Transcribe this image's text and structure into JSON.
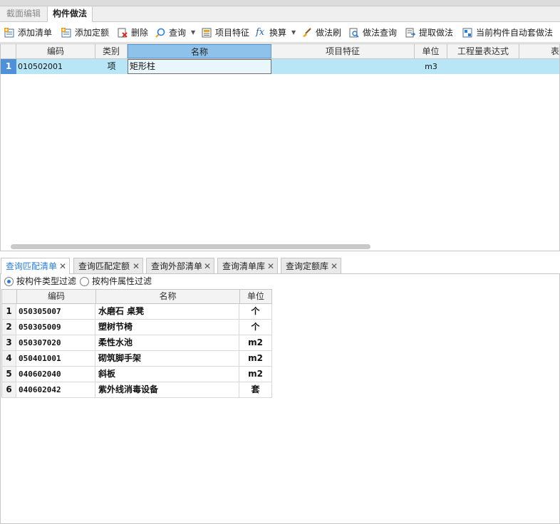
{
  "tabs_top": [
    {
      "label": "截面编辑",
      "active": false
    },
    {
      "label": "构件做法",
      "active": true
    }
  ],
  "toolbar": {
    "add_list": "添加清单",
    "add_quota": "添加定额",
    "delete": "删除",
    "query": "查询",
    "item_feature": "项目特征",
    "convert": "换算",
    "method_brush": "做法刷",
    "method_query": "做法查询",
    "extract_method": "提取做法",
    "auto_apply": "当前构件自动套做法"
  },
  "grid_main": {
    "headers": [
      "编码",
      "类别",
      "名称",
      "项目特征",
      "单位",
      "工程量表达式",
      "表"
    ],
    "rows": [
      {
        "num": "1",
        "code": "010502001",
        "category": "项",
        "name": "矩形柱",
        "feature": "",
        "unit": "m3",
        "expr": "",
        "more": ""
      }
    ]
  },
  "bottom_tabs": [
    {
      "label": "查询匹配清单",
      "active": true
    },
    {
      "label": "查询匹配定额",
      "active": false
    },
    {
      "label": "查询外部清单",
      "active": false
    },
    {
      "label": "查询清单库",
      "active": false
    },
    {
      "label": "查询定额库",
      "active": false
    }
  ],
  "close_glyph": "✕",
  "filters": {
    "by_type": "按构件类型过滤",
    "by_attr": "按构件属性过滤",
    "selected": "by_type"
  },
  "grid_match": {
    "headers": [
      "编码",
      "名称",
      "单位"
    ],
    "rows": [
      {
        "num": "1",
        "code": "050305007",
        "name": "水磨石 桌凳",
        "unit": "个"
      },
      {
        "num": "2",
        "code": "050305009",
        "name": "塑树节椅",
        "unit": "个"
      },
      {
        "num": "3",
        "code": "050307020",
        "name": "柔性水池",
        "unit": "m2"
      },
      {
        "num": "4",
        "code": "050401001",
        "name": "砌筑脚手架",
        "unit": "m2"
      },
      {
        "num": "5",
        "code": "040602040",
        "name": "斜板",
        "unit": "m2"
      },
      {
        "num": "6",
        "code": "040602042",
        "name": "紫外线消毒设备",
        "unit": "套"
      }
    ]
  },
  "colors": {
    "accent": "#2a7dd1",
    "row_selected": "#b8e6f7",
    "header_selected": "#8ec2ea"
  }
}
